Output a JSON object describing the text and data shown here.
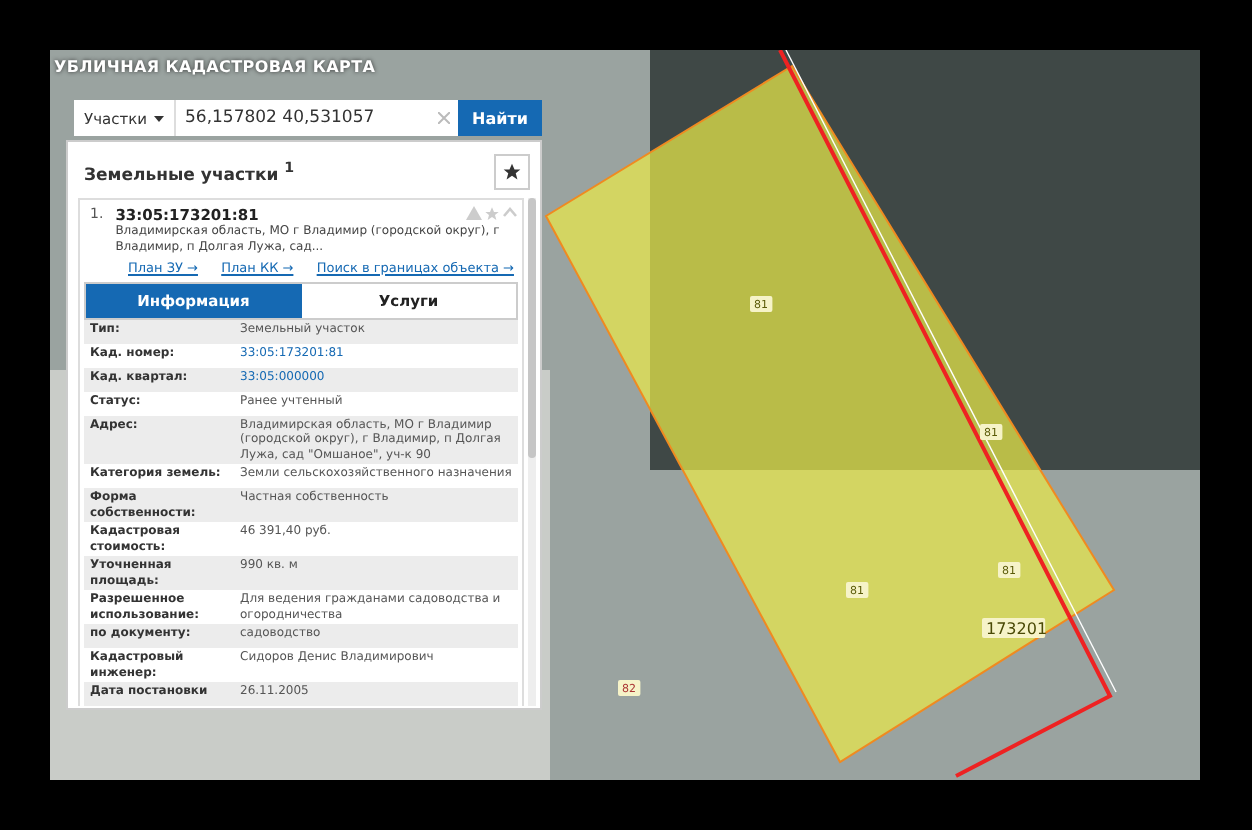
{
  "map": {
    "title": "УБЛИЧНАЯ КАДАСТРОВАЯ КАРТА",
    "labels": [
      {
        "text": "81",
        "kind": "plot"
      },
      {
        "text": "81",
        "kind": "plot"
      },
      {
        "text": "81",
        "kind": "plot"
      },
      {
        "text": "81",
        "kind": "plot"
      },
      {
        "text": "173201",
        "kind": "quarter"
      },
      {
        "text": "82",
        "kind": "other"
      }
    ]
  },
  "search": {
    "layer": "Участки",
    "value": "56,157802 40,531057",
    "button": "Найти"
  },
  "panel": {
    "title": "Земельные участки $^{1}$",
    "result": {
      "index": "1.",
      "number": "33:05:173201:81",
      "address": "Владимирская область, МО г Владимир (городской округ), г Владимир, п Долгая Лужа, сад...",
      "links": [
        "План ЗУ →",
        "План КК →",
        "Поиск в границах объекта →"
      ]
    },
    "tabs": [
      {
        "label": "Информация",
        "selected": true
      },
      {
        "label": "Услуги",
        "selected": false
      }
    ],
    "rows": [
      {
        "label": "Тип:",
        "value": "Земельный участок",
        "kind": "text"
      },
      {
        "label": "Кад. номер:",
        "value": "33:05:173201:81",
        "kind": "link"
      },
      {
        "label": "Кад. квартал:",
        "value": "33:05:000000",
        "kind": "link"
      },
      {
        "label": "Статус:",
        "value": "Ранее учтенный",
        "kind": "text"
      },
      {
        "label": "Адрес:",
        "value": "Владимирская область, МО г Владимир (городской округ), г Владимир, п Долгая Лужа, сад \"Омшаное\", уч-к 90",
        "kind": "text"
      },
      {
        "label": "Категория земель:",
        "value": "Земли сельскохозяйственного назначения",
        "kind": "text"
      },
      {
        "label": "Форма собственности:",
        "value": "Частная собственность",
        "kind": "text"
      },
      {
        "label": "Кадастровая стоимость:",
        "value": "46 391,40 руб.",
        "kind": "text"
      },
      {
        "label": "Уточненная площадь:",
        "value": "990 кв. м",
        "kind": "text"
      },
      {
        "label": "Разрешенное использование:",
        "value": "Для ведения гражданами садоводства и огородничества",
        "kind": "text"
      },
      {
        "label": "по документу:",
        "value": "садоводство",
        "kind": "text"
      },
      {
        "label": "Кадастровый инженер:",
        "value": "Сидоров Денис Владимирович",
        "kind": "text"
      },
      {
        "label": "Дата постановки",
        "value": "26.11.2005",
        "kind": "text"
      }
    ]
  }
}
